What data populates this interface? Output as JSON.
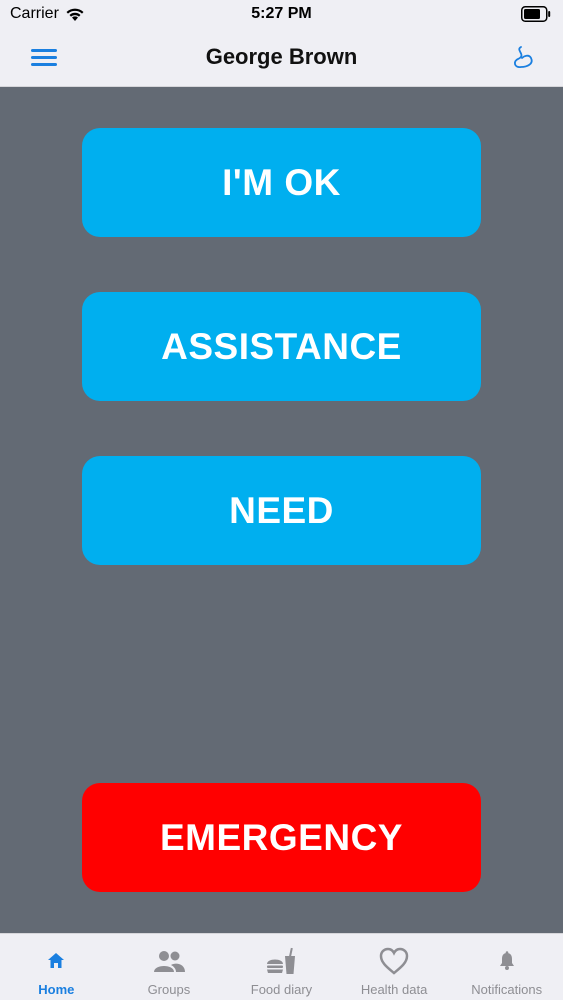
{
  "status_bar": {
    "carrier": "Carrier",
    "time": "5:27 PM"
  },
  "header": {
    "title": "George Brown"
  },
  "actions": {
    "ok_label": "I'M OK",
    "assistance_label": "ASSISTANCE",
    "need_label": "NEED",
    "emergency_label": "EMERGENCY"
  },
  "tabs": [
    {
      "label": "Home",
      "icon": "home-icon",
      "active": true
    },
    {
      "label": "Groups",
      "icon": "groups-icon",
      "active": false
    },
    {
      "label": "Food diary",
      "icon": "food-icon",
      "active": false
    },
    {
      "label": "Health data",
      "icon": "heart-icon",
      "active": false
    },
    {
      "label": "Notifications",
      "icon": "bell-icon",
      "active": false
    }
  ],
  "colors": {
    "primary": "#00afef",
    "emergency": "#ff0000",
    "background": "#636a74",
    "accent": "#1a7fe0"
  }
}
